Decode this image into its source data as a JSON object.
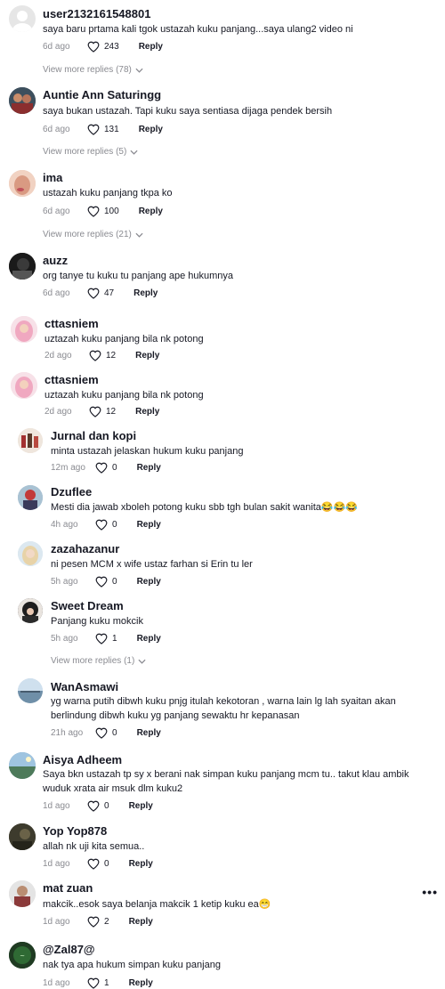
{
  "comments": [
    {
      "user": "user2132161548801",
      "text": "saya baru prtama kali tgok ustazah kuku panjang...saya ulang2 video ni",
      "age": "6d ago",
      "likes": "243",
      "reply": "Reply",
      "view_more": "View more replies (78)"
    },
    {
      "user": "Auntie Ann Saturingg",
      "text": "saya bukan ustazah. Tapi kuku saya sentiasa dijaga pendek bersih",
      "age": "6d ago",
      "likes": "131",
      "reply": "Reply",
      "view_more": "View more replies (5)"
    },
    {
      "user": "ima",
      "text": "ustazah kuku panjang tkpa ko",
      "age": "6d ago",
      "likes": "100",
      "reply": "Reply",
      "view_more": "View more replies (21)"
    },
    {
      "user": "auzz",
      "text": "org tanye tu kuku tu panjang ape hukumnya",
      "age": "6d ago",
      "likes": "47",
      "reply": "Reply"
    },
    {
      "user": "cttasniem",
      "text": "uztazah kuku panjang bila nk potong",
      "age": "2d ago",
      "likes": "12",
      "reply": "Reply"
    },
    {
      "user": "cttasniem",
      "text": "uztazah kuku panjang bila nk potong",
      "age": "2d ago",
      "likes": "12",
      "reply": "Reply"
    },
    {
      "user": "Jurnal dan kopi",
      "text": "minta ustazah jelaskan hukum kuku panjang",
      "age": "12m ago",
      "likes": "0",
      "reply": "Reply"
    },
    {
      "user": "Dzuflee",
      "text": "Mesti dia jawab xboleh potong kuku sbb tgh bulan sakit wanita😂😂😂",
      "age": "4h ago",
      "likes": "0",
      "reply": "Reply"
    },
    {
      "user": "zazahazanur",
      "text": "ni pesen MCM x wife ustaz farhan si Erin tu ler",
      "age": "5h ago",
      "likes": "0",
      "reply": "Reply"
    },
    {
      "user": "Sweet Dream",
      "text": "Panjang kuku mokcik",
      "age": "5h ago",
      "likes": "1",
      "reply": "Reply",
      "view_more": "View more replies (1)"
    },
    {
      "user": "WanAsmawi",
      "text": "yg warna putih dibwh kuku pnjg itulah kekotoran , warna lain lg lah syaitan akan berlindung dibwh kuku yg panjang sewaktu hr kepanasan",
      "age": "21h ago",
      "likes": "0",
      "reply": "Reply"
    },
    {
      "user": "Aisya Adheem",
      "text": "Saya bkn ustazah tp sy x berani nak simpan kuku panjang mcm tu.. takut klau ambik wuduk xrata air msuk dlm kuku2",
      "age": "1d ago",
      "likes": "0",
      "reply": "Reply"
    },
    {
      "user": "Yop Yop878",
      "text": "allah nk uji kita semua..",
      "age": "1d ago",
      "likes": "0",
      "reply": "Reply"
    },
    {
      "user": "mat zuan",
      "text": "makcik..esok saya belanja makcik 1 ketip kuku ea😁",
      "age": "1d ago",
      "likes": "2",
      "reply": "Reply"
    },
    {
      "user": "@Zal87@",
      "text": "nak tya apa hukum simpan kuku panjang",
      "age": "1d ago",
      "likes": "1",
      "reply": "Reply"
    }
  ],
  "more_icon": "more-options-icon",
  "colors": {
    "text": "#161823",
    "muted": "#8a8b91",
    "bg": "#ffffff"
  }
}
